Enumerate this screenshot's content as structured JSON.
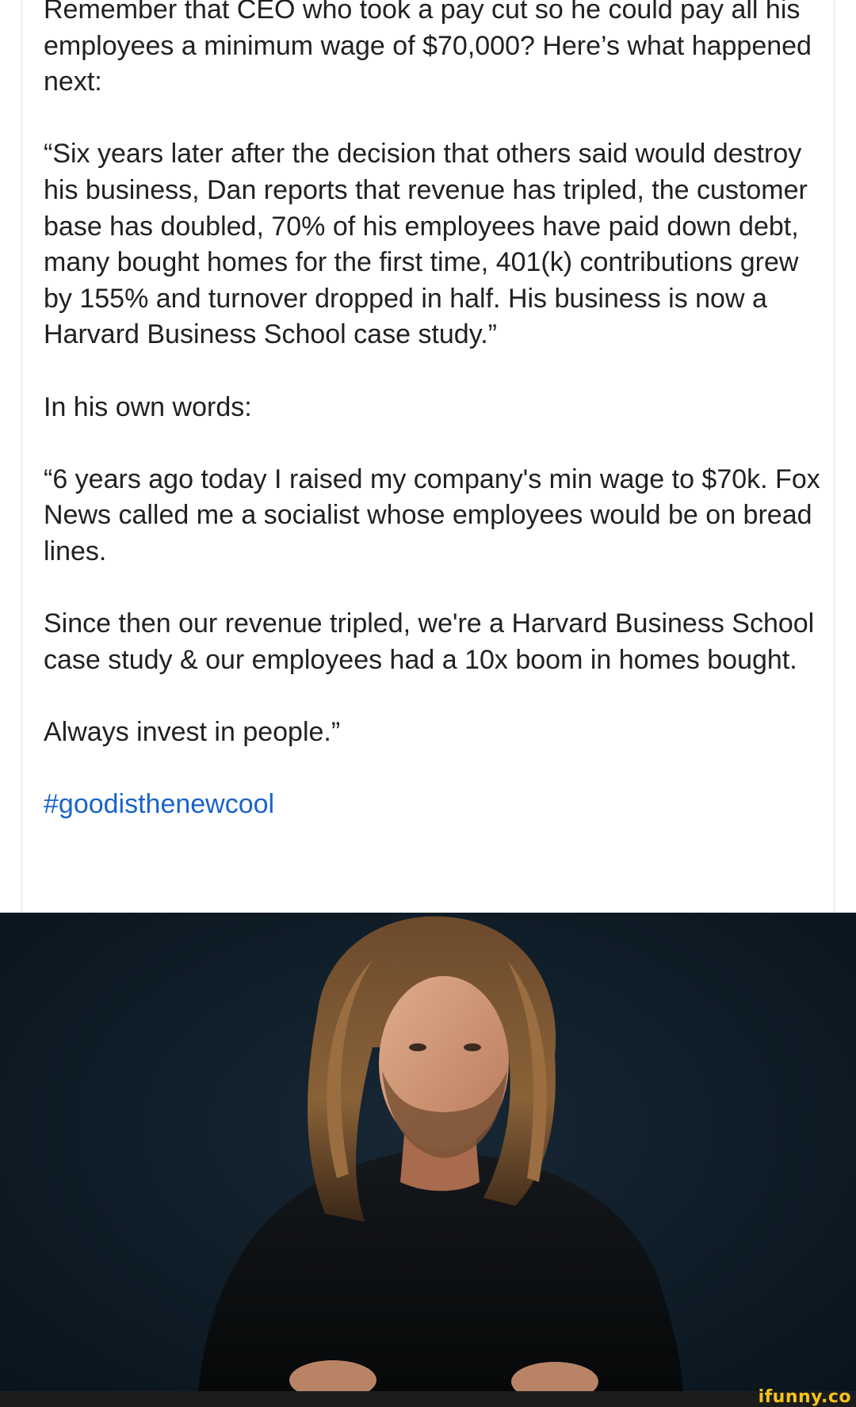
{
  "post": {
    "paragraphs": [
      "Remember that CEO who took a pay cut so he could pay all his employees a minimum wage of $70,000? Here’s what happened next:",
      "“Six years later after the decision that others said would destroy his business, Dan reports that revenue has tripled, the customer base has doubled, 70% of his employees have paid down debt, many bought homes for the first time, 401(k) contributions grew by 155% and turnover dropped in half. His business is now a Harvard Business School case study.”",
      "In his own words:",
      "“6 years ago today I raised my company's min wage to $70k. Fox News called me a socialist whose employees would be on bread lines.",
      "Since then our revenue tripled, we're a Harvard Business School case study & our employees had a 10x boom in homes bought.",
      "Always invest in people.”"
    ],
    "hashtag": "#goodisthenewcool"
  },
  "photo": {
    "description_icon": "portrait-photo"
  },
  "watermark": {
    "text": "ifunny.co"
  },
  "colors": {
    "text": "#202124",
    "hashtag": "#1a64c8",
    "photo_background": "#0f1d28",
    "watermark": "#f5c518"
  }
}
